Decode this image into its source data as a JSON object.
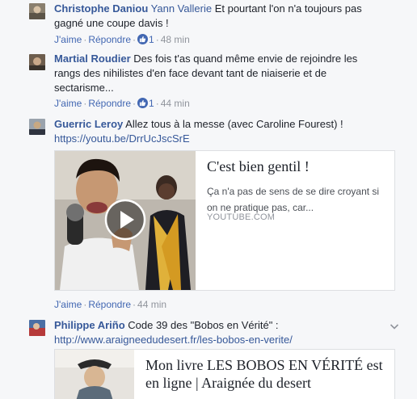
{
  "comments": [
    {
      "author": "Christophe Daniou",
      "mention": "Yann Vallerie",
      "text": " Et pourtant l'on n'a toujours pas gagné une coupe davis !",
      "actions": {
        "like": "J'aime",
        "reply": "Répondre",
        "likes": "1",
        "time": "48 min"
      }
    },
    {
      "author": "Martial Roudier",
      "text": " Des fois t'as quand même envie de rejoindre les rangs des nihilistes d'en face devant tant de niaiserie et de sectarisme...",
      "actions": {
        "like": "J'aime",
        "reply": "Répondre",
        "likes": "1",
        "time": "44 min"
      }
    },
    {
      "author": "Guerric Leroy",
      "text": " Allez tous à la messe (avec Caroline Fourest) !",
      "link": "https://youtu.be/DrrUcJscSrE",
      "preview": {
        "title": "C'est bien gentil !",
        "description": "Ça n'a pas de sens de se dire croyant si on ne pratique pas, car...",
        "domain": "YOUTUBE.COM"
      },
      "actions": {
        "like": "J'aime",
        "reply": "Répondre",
        "time": "44 min"
      }
    },
    {
      "author": "Philippe Ariño",
      "text": " Code 39 des \"Bobos en Vérité\" :",
      "link": "http://www.araigneedudesert.fr/les-bobos-en-verite/",
      "preview": {
        "title": "Mon livre LES BOBOS EN VÉRITÉ est en ligne | Araignée du desert"
      }
    }
  ],
  "separator": "·",
  "icons": {
    "like": "thumbs-up-icon",
    "play": "play-icon",
    "options": "chevron-down-icon"
  },
  "colors": {
    "link": "#365899",
    "action": "#4267b2",
    "meta": "#90949c",
    "background": "#f6f7f9"
  }
}
